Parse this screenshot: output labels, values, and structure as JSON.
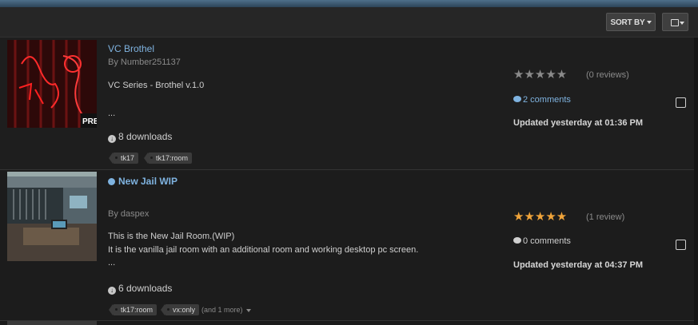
{
  "toolbar": {
    "sort_label": "SORT BY"
  },
  "items": [
    {
      "title": "VC Brothel",
      "author": "By Number251137",
      "description": "VC Series - Brothel v.1.0",
      "ellipsis": "...",
      "downloads": "8 downloads",
      "tags": [
        "tk17",
        "tk17:room"
      ],
      "rating_text": "(0 reviews)",
      "comments": "2 comments",
      "updated": "Updated yesterday at 01:36 PM",
      "thumb_badge": "PRE"
    },
    {
      "title": "New Jail WIP",
      "author": "By daspex",
      "description_lines": [
        "This is the New Jail Room.(WIP)",
        "It is the vanilla jail room with an additional room and working desktop pc screen."
      ],
      "ellipsis": "...",
      "downloads": "6 downloads",
      "tags": [
        "tk17:room",
        "vx:only"
      ],
      "more_tags": "(and 1 more)",
      "rating_text": "(1 review)",
      "comments": "0 comments",
      "updated": "Updated yesterday at 04:37 PM"
    }
  ],
  "colors": {
    "link": "#7fb3e0",
    "star_gold": "#f0a43a",
    "star_grey": "#8a8a8a"
  }
}
